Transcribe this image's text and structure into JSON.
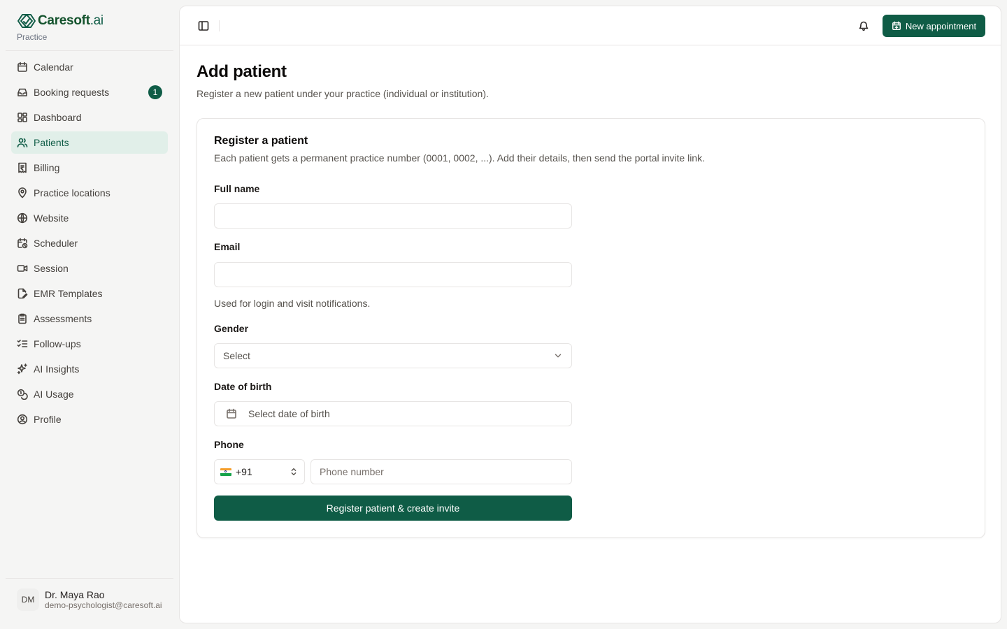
{
  "brand": {
    "name": "Caresoft",
    "suffix": ".ai",
    "subtitle": "Practice",
    "color": "#0f5c46"
  },
  "sidebar": {
    "items": [
      {
        "label": "Calendar",
        "icon": "calendar-icon"
      },
      {
        "label": "Booking requests",
        "icon": "inbox-icon",
        "badge": "1"
      },
      {
        "label": "Dashboard",
        "icon": "layout-dashboard-icon"
      },
      {
        "label": "Patients",
        "icon": "users-icon",
        "active": true
      },
      {
        "label": "Billing",
        "icon": "receipt-rupee-icon"
      },
      {
        "label": "Practice locations",
        "icon": "map-pin-icon"
      },
      {
        "label": "Website",
        "icon": "globe-icon"
      },
      {
        "label": "Scheduler",
        "icon": "calendar-clock-icon"
      },
      {
        "label": "Session",
        "icon": "video-icon"
      },
      {
        "label": "EMR Templates",
        "icon": "file-pen-icon"
      },
      {
        "label": "Assessments",
        "icon": "clipboard-icon"
      },
      {
        "label": "Follow-ups",
        "icon": "list-checks-icon"
      },
      {
        "label": "AI Insights",
        "icon": "sparkles-icon"
      },
      {
        "label": "AI Usage",
        "icon": "coins-icon"
      },
      {
        "label": "Profile",
        "icon": "user-circle-icon"
      }
    ]
  },
  "user": {
    "initials": "DM",
    "name": "Dr. Maya Rao",
    "email": "demo-psychologist@caresoft.ai"
  },
  "topbar": {
    "new_appointment_label": "New appointment"
  },
  "page": {
    "title": "Add patient",
    "subtitle": "Register a new patient under your practice (individual or institution)."
  },
  "form": {
    "title": "Register a patient",
    "description": "Each patient gets a permanent practice number (0001, 0002, ...). Add their details, then send the portal invite link.",
    "full_name": {
      "label": "Full name",
      "value": ""
    },
    "email": {
      "label": "Email",
      "value": "",
      "hint": "Used for login and visit notifications."
    },
    "gender": {
      "label": "Gender",
      "placeholder": "Select"
    },
    "dob": {
      "label": "Date of birth",
      "placeholder": "Select date of birth"
    },
    "phone": {
      "label": "Phone",
      "country_code": "+91",
      "placeholder": "Phone number",
      "value": ""
    },
    "submit_label": "Register patient & create invite"
  }
}
